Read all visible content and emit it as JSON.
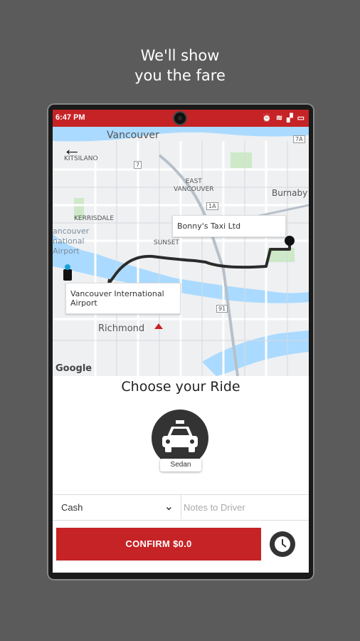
{
  "promo": {
    "line1": "We'll show",
    "line2": "you the fare"
  },
  "status_bar": {
    "time": "6:47 PM"
  },
  "map": {
    "labels": {
      "vancouver": "Vancouver",
      "kitsilano": "KITSILANO",
      "east_vancouver": "EAST\nVANCOUVER",
      "burnaby": "Burnaby",
      "kerrisdale": "KERRISDALE",
      "sunset": "SUNSET",
      "vancouver_airport_area": "ancouver\nnational\nAirport",
      "richmond": "Richmond",
      "google": "Google",
      "hwy_7": "7",
      "hwy_1a": "1A",
      "hwy_7a": "7A",
      "hwy_91": "91"
    },
    "origin_callout": "Bonny's Taxi Ltd",
    "destination_callout": "Vancouver International\nAirport"
  },
  "ride": {
    "heading": "Choose your Ride",
    "vehicle_label": "Sedan"
  },
  "payment": {
    "selected": "Cash"
  },
  "notes": {
    "placeholder": "Notes to Driver"
  },
  "confirm": {
    "label": "CONFIRM $0.0"
  },
  "colors": {
    "accent": "#c62326",
    "background": "#5b5b5b",
    "dark": "#333333"
  }
}
